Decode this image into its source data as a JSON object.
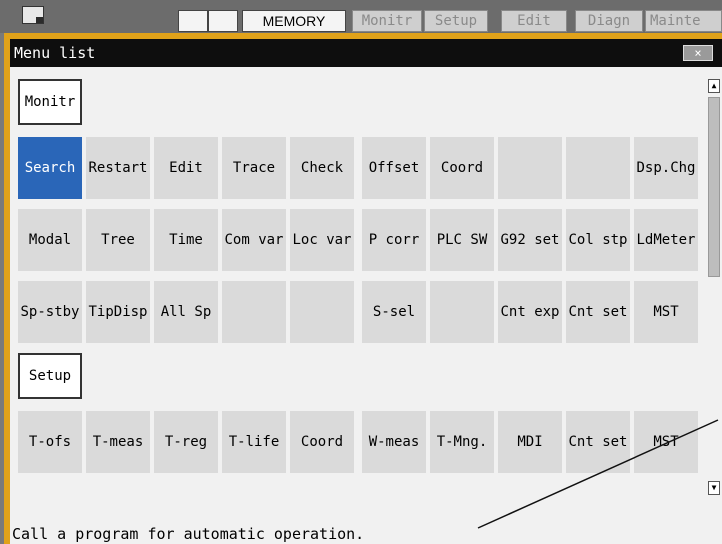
{
  "topbar": {
    "logo_icon": "screen-icon",
    "mode": "MEMORY",
    "tabs": [
      {
        "label": "Monitr",
        "active": true
      },
      {
        "label": "Setup",
        "active": false
      },
      {
        "label": "Edit",
        "active": false
      },
      {
        "label": "Diagn",
        "active": false
      },
      {
        "label": "Mainte",
        "active": false
      }
    ]
  },
  "panel": {
    "title": "Menu list",
    "close_label": "×",
    "groups": [
      {
        "label": "Monitr",
        "rows": [
          [
            "Search",
            "Restart",
            "Edit",
            "Trace",
            "Check",
            "Offset",
            "Coord",
            "",
            "",
            "Dsp.Chg"
          ],
          [
            "Modal",
            "Tree",
            "Time",
            "Com var",
            "Loc var",
            "P corr",
            "PLC SW",
            "G92 set",
            "Col stp",
            "LdMeter"
          ],
          [
            "Sp-stby",
            "TipDisp",
            "All Sp",
            "",
            "",
            "S-sel",
            "",
            "Cnt exp",
            "Cnt set",
            "MST"
          ]
        ]
      },
      {
        "label": "Setup",
        "rows": [
          [
            "T-ofs",
            "T-meas",
            "T-reg",
            "T-life",
            "Coord",
            "W-meas",
            "T-Mng.",
            "MDI",
            "Cnt set",
            "MST"
          ]
        ]
      }
    ],
    "selected": "Search",
    "scroll_up": "▲",
    "scroll_down": "▼",
    "message": "Call a program for automatic operation."
  },
  "colors": {
    "accent": "#2a66b8",
    "frame": "#e0a21a",
    "title_bg": "#0e0e0e",
    "cell_bg": "#dadada"
  }
}
